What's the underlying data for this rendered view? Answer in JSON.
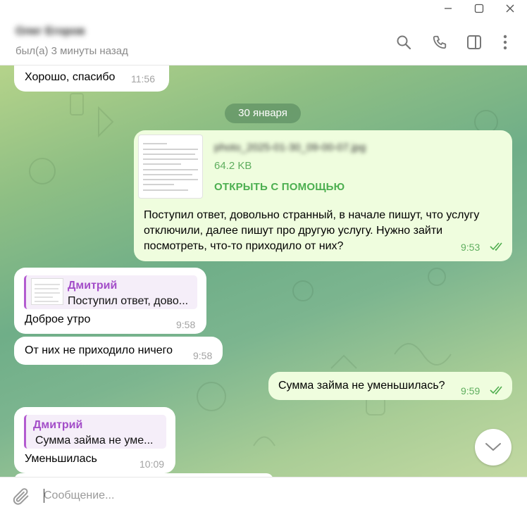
{
  "window": {
    "minimize_icon": "minimize-icon",
    "maximize_icon": "maximize-icon",
    "close_icon": "close-icon"
  },
  "header": {
    "contact_name": "Олег Егоров",
    "status": "был(а) 3 минуты назад",
    "icons": [
      "search-icon",
      "phone-icon",
      "sidebar-toggle-icon",
      "more-vertical-icon"
    ]
  },
  "messages": {
    "m1": {
      "text": "Хорошо, спасибо",
      "time": "11:56"
    },
    "date_separator": "30 января",
    "m2": {
      "file_name": "photo_2025-01-30_09-00-07.jpg",
      "file_size": "64.2 KB",
      "open_with": "ОТКРЫТЬ С ПОМОЩЬЮ",
      "text_lines": [
        "Поступил ответ, довольно странный, в начале пишут, что услугу",
        "отключили, далее пишут про другую услугу. Нужно зайти",
        "посмотреть, что-то приходило от них?"
      ],
      "time": "9:53"
    },
    "m3": {
      "reply_name": "Дмитрий",
      "reply_text": "Поступил ответ, дово...",
      "text": "Доброе утро",
      "time": "9:58"
    },
    "m4": {
      "text": "От них не приходило ничего",
      "time": "9:58"
    },
    "m5": {
      "text": "Сумма займа не уменьшилась?",
      "time": "9:59"
    },
    "m6": {
      "reply_name": "Дмитрий",
      "reply_text": "Сумма займа не уме...",
      "text": "Уменьшилась",
      "time": "10:09"
    }
  },
  "composer": {
    "placeholder": "Сообщение...",
    "value": "",
    "attach_icon": "paperclip-icon"
  },
  "colors": {
    "outgoing_bubble": "#effdde",
    "incoming_bubble": "#ffffff",
    "accent_green": "#4caf50",
    "reply_purple": "#a34dc8"
  }
}
